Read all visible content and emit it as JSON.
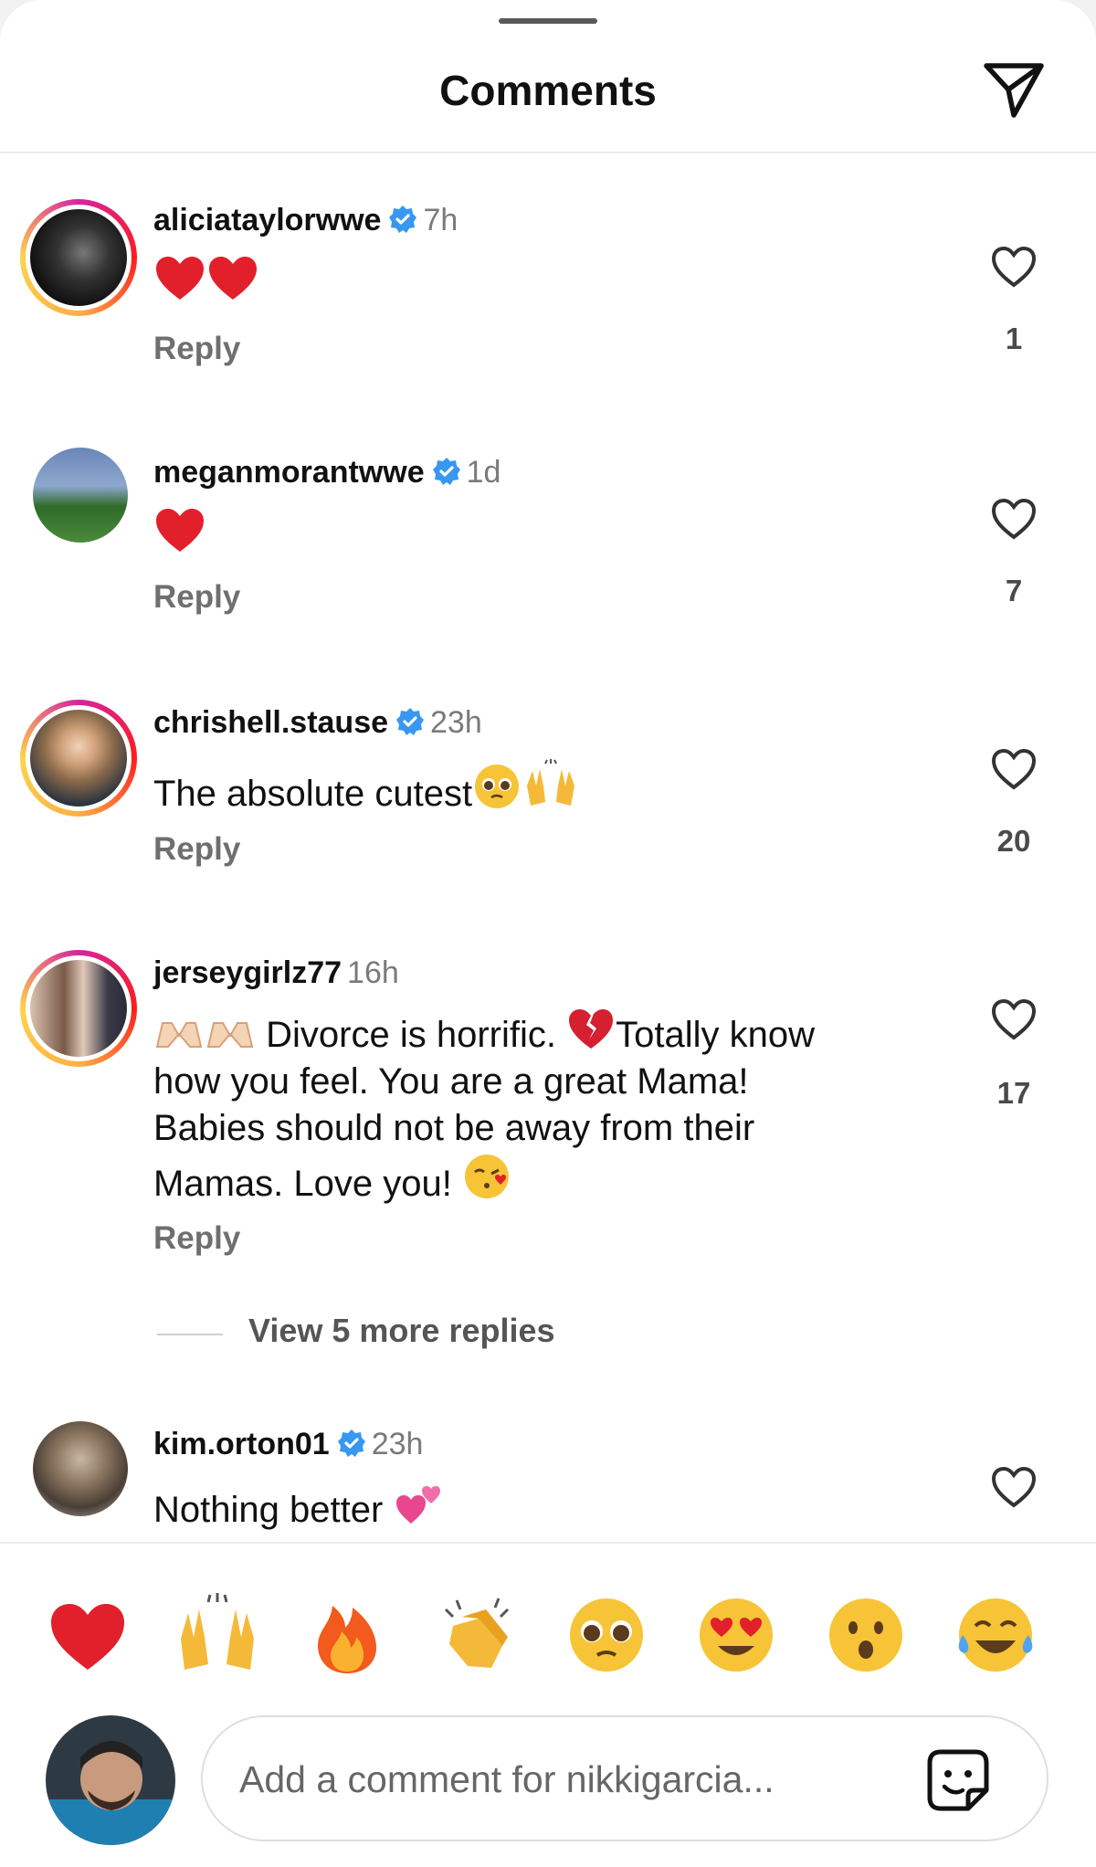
{
  "header": {
    "title": "Comments",
    "share_icon": "paper-plane-icon"
  },
  "comments": [
    {
      "username": "aliciataylorwwe",
      "verified": true,
      "time": "7h",
      "text": "",
      "emojis_after": [
        "heart",
        "heart"
      ],
      "reply_label": "Reply",
      "likes": "1"
    },
    {
      "username": "meganmorantwwe",
      "verified": true,
      "time": "1d",
      "text": "",
      "emojis_after": [
        "heart"
      ],
      "reply_label": "Reply",
      "likes": "7"
    },
    {
      "username": "chrishell.stause",
      "verified": true,
      "time": "23h",
      "text": "The absolute cutest",
      "emojis_after": [
        "pleading-face",
        "raising-hands"
      ],
      "reply_label": "Reply",
      "likes": "20"
    },
    {
      "username": "jerseygirlz77",
      "verified": false,
      "time": "16h",
      "line1": "Divorce is horrific.",
      "line1b": "Totally know",
      "line2": "how you feel. You are a great Mama!",
      "line3": "Babies should not be away from their",
      "line4": "Mamas. Love you!",
      "reply_label": "Reply",
      "likes": "17"
    },
    {
      "username": "kim.orton01",
      "verified": true,
      "time": "23h",
      "text": "Nothing better",
      "emojis_after": [
        "two-hearts"
      ],
      "likes": ""
    }
  ],
  "more_replies": "View 5 more replies",
  "emoji_bar": [
    "heart",
    "raising-hands",
    "fire",
    "clapping-hands",
    "pleading-face",
    "heart-eyes",
    "surprised-face",
    "tears-of-joy"
  ],
  "composer": {
    "placeholder": "Add a comment for nikkigarcia...",
    "value": "",
    "sticker_icon": "sticker-icon"
  },
  "colors": {
    "verified": "#3897f0",
    "heart_emoji": "#e2202b",
    "text": "#111111",
    "muted": "#7a7a7a"
  }
}
